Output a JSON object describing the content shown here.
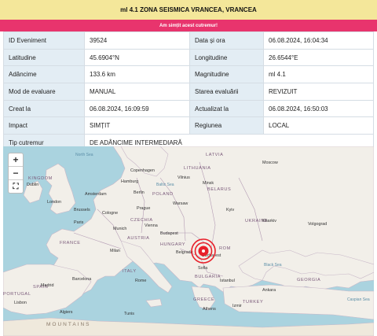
{
  "header": {
    "title": "ml 4.1 ZONA SEISMICA VRANCEA, VRANCEA",
    "alert": "Am simțit acest cutremur!"
  },
  "details": [
    {
      "l1": "ID Eveniment",
      "v1": "39524",
      "l2": "Data și ora",
      "v2": "06.08.2024, 16:04:34"
    },
    {
      "l1": "Latitudine",
      "v1": "45.6904°N",
      "l2": "Longitudine",
      "v2": "26.6544°E"
    },
    {
      "l1": "Adâncime",
      "v1": "133.6 km",
      "l2": "Magnitudine",
      "v2": "ml 4.1"
    },
    {
      "l1": "Mod de evaluare",
      "v1": "MANUAL",
      "l2": "Starea evaluării",
      "v2": "REVIZUIT"
    },
    {
      "l1": "Creat la",
      "v1": "06.08.2024, 16:09:59",
      "l2": "Actualizat la",
      "v2": "06.08.2024, 16:50:03"
    },
    {
      "l1": "Impact",
      "v1": "SIMȚIT",
      "l2": "Regiunea",
      "v2": "LOCAL"
    }
  ],
  "type_row": {
    "label": "Tip cutremur",
    "value": "DE ADÂNCIME INTERMEDIARĂ"
  },
  "map": {
    "zoom_in": "+",
    "zoom_out": "−",
    "fullscreen": "⛶",
    "countries": [
      "LATVIA",
      "LITHUANIA",
      "BELARUS",
      "POLAND",
      "CZECHIA",
      "AUSTRIA",
      "HUNGARY",
      "FRANCE",
      "SPAIN",
      "PORTUGAL",
      "ITALY",
      "GREECE",
      "TURKEY",
      "BULGARIA",
      "GEORGIA",
      "KINGDOM",
      "UKRAINE",
      "ROM"
    ],
    "cities": [
      "Moscow",
      "Copenhagen",
      "Vilnius",
      "Minsk",
      "Dublin",
      "Hamburg",
      "Berlin",
      "Amsterdam",
      "London",
      "Brussels",
      "Cologne",
      "Prague",
      "Warsaw",
      "Kyiv",
      "Kharkiv",
      "Volgograd",
      "Paris",
      "Munich",
      "Vienna",
      "Budapest",
      "Milan",
      "Belgrade",
      "Bucharest",
      "Barcelona",
      "Madrid",
      "Rome",
      "Sofia",
      "Istanbul",
      "Ankara",
      "Lisbon",
      "Athens",
      "Izmir",
      "Algiers",
      "Tunis"
    ],
    "seas": [
      "Black Sea",
      "North Sea",
      "Baltic Sea",
      "Caspian Sea"
    ],
    "mountains": "MOUNTAINS",
    "colors": {
      "water": "#aad3df",
      "land": "#f2efe9",
      "epicenter": "#e8202a"
    }
  }
}
